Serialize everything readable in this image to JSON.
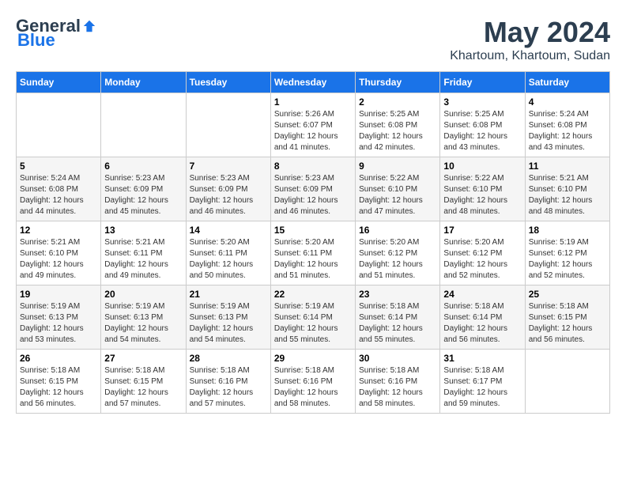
{
  "header": {
    "logo_general": "General",
    "logo_blue": "Blue",
    "month": "May 2024",
    "location": "Khartoum, Khartoum, Sudan"
  },
  "days_of_week": [
    "Sunday",
    "Monday",
    "Tuesday",
    "Wednesday",
    "Thursday",
    "Friday",
    "Saturday"
  ],
  "weeks": [
    [
      {
        "day": "",
        "info": ""
      },
      {
        "day": "",
        "info": ""
      },
      {
        "day": "",
        "info": ""
      },
      {
        "day": "1",
        "info": "Sunrise: 5:26 AM\nSunset: 6:07 PM\nDaylight: 12 hours\nand 41 minutes."
      },
      {
        "day": "2",
        "info": "Sunrise: 5:25 AM\nSunset: 6:08 PM\nDaylight: 12 hours\nand 42 minutes."
      },
      {
        "day": "3",
        "info": "Sunrise: 5:25 AM\nSunset: 6:08 PM\nDaylight: 12 hours\nand 43 minutes."
      },
      {
        "day": "4",
        "info": "Sunrise: 5:24 AM\nSunset: 6:08 PM\nDaylight: 12 hours\nand 43 minutes."
      }
    ],
    [
      {
        "day": "5",
        "info": "Sunrise: 5:24 AM\nSunset: 6:08 PM\nDaylight: 12 hours\nand 44 minutes."
      },
      {
        "day": "6",
        "info": "Sunrise: 5:23 AM\nSunset: 6:09 PM\nDaylight: 12 hours\nand 45 minutes."
      },
      {
        "day": "7",
        "info": "Sunrise: 5:23 AM\nSunset: 6:09 PM\nDaylight: 12 hours\nand 46 minutes."
      },
      {
        "day": "8",
        "info": "Sunrise: 5:23 AM\nSunset: 6:09 PM\nDaylight: 12 hours\nand 46 minutes."
      },
      {
        "day": "9",
        "info": "Sunrise: 5:22 AM\nSunset: 6:10 PM\nDaylight: 12 hours\nand 47 minutes."
      },
      {
        "day": "10",
        "info": "Sunrise: 5:22 AM\nSunset: 6:10 PM\nDaylight: 12 hours\nand 48 minutes."
      },
      {
        "day": "11",
        "info": "Sunrise: 5:21 AM\nSunset: 6:10 PM\nDaylight: 12 hours\nand 48 minutes."
      }
    ],
    [
      {
        "day": "12",
        "info": "Sunrise: 5:21 AM\nSunset: 6:10 PM\nDaylight: 12 hours\nand 49 minutes."
      },
      {
        "day": "13",
        "info": "Sunrise: 5:21 AM\nSunset: 6:11 PM\nDaylight: 12 hours\nand 49 minutes."
      },
      {
        "day": "14",
        "info": "Sunrise: 5:20 AM\nSunset: 6:11 PM\nDaylight: 12 hours\nand 50 minutes."
      },
      {
        "day": "15",
        "info": "Sunrise: 5:20 AM\nSunset: 6:11 PM\nDaylight: 12 hours\nand 51 minutes."
      },
      {
        "day": "16",
        "info": "Sunrise: 5:20 AM\nSunset: 6:12 PM\nDaylight: 12 hours\nand 51 minutes."
      },
      {
        "day": "17",
        "info": "Sunrise: 5:20 AM\nSunset: 6:12 PM\nDaylight: 12 hours\nand 52 minutes."
      },
      {
        "day": "18",
        "info": "Sunrise: 5:19 AM\nSunset: 6:12 PM\nDaylight: 12 hours\nand 52 minutes."
      }
    ],
    [
      {
        "day": "19",
        "info": "Sunrise: 5:19 AM\nSunset: 6:13 PM\nDaylight: 12 hours\nand 53 minutes."
      },
      {
        "day": "20",
        "info": "Sunrise: 5:19 AM\nSunset: 6:13 PM\nDaylight: 12 hours\nand 54 minutes."
      },
      {
        "day": "21",
        "info": "Sunrise: 5:19 AM\nSunset: 6:13 PM\nDaylight: 12 hours\nand 54 minutes."
      },
      {
        "day": "22",
        "info": "Sunrise: 5:19 AM\nSunset: 6:14 PM\nDaylight: 12 hours\nand 55 minutes."
      },
      {
        "day": "23",
        "info": "Sunrise: 5:18 AM\nSunset: 6:14 PM\nDaylight: 12 hours\nand 55 minutes."
      },
      {
        "day": "24",
        "info": "Sunrise: 5:18 AM\nSunset: 6:14 PM\nDaylight: 12 hours\nand 56 minutes."
      },
      {
        "day": "25",
        "info": "Sunrise: 5:18 AM\nSunset: 6:15 PM\nDaylight: 12 hours\nand 56 minutes."
      }
    ],
    [
      {
        "day": "26",
        "info": "Sunrise: 5:18 AM\nSunset: 6:15 PM\nDaylight: 12 hours\nand 56 minutes."
      },
      {
        "day": "27",
        "info": "Sunrise: 5:18 AM\nSunset: 6:15 PM\nDaylight: 12 hours\nand 57 minutes."
      },
      {
        "day": "28",
        "info": "Sunrise: 5:18 AM\nSunset: 6:16 PM\nDaylight: 12 hours\nand 57 minutes."
      },
      {
        "day": "29",
        "info": "Sunrise: 5:18 AM\nSunset: 6:16 PM\nDaylight: 12 hours\nand 58 minutes."
      },
      {
        "day": "30",
        "info": "Sunrise: 5:18 AM\nSunset: 6:16 PM\nDaylight: 12 hours\nand 58 minutes."
      },
      {
        "day": "31",
        "info": "Sunrise: 5:18 AM\nSunset: 6:17 PM\nDaylight: 12 hours\nand 59 minutes."
      },
      {
        "day": "",
        "info": ""
      }
    ]
  ]
}
